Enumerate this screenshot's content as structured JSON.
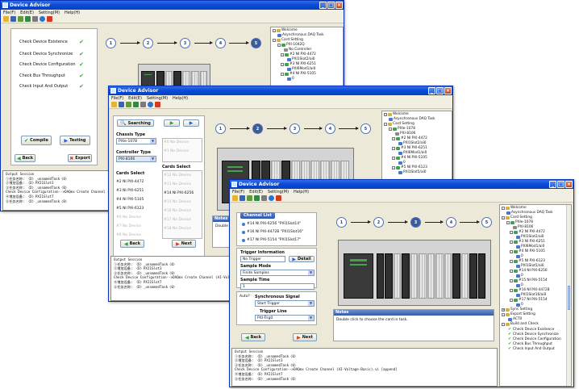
{
  "app": {
    "title": "Device Advisor",
    "menu": [
      "File(F)",
      "Edit(E)",
      "Setting(M)",
      "Help(H)"
    ]
  },
  "icons": {
    "ok": "✔",
    "compile": "✔",
    "testing": "▶",
    "back": "◀",
    "export": "✖",
    "next": "▶",
    "searching": "🔍",
    "arrow": "▶"
  },
  "win1": {
    "checks": [
      "Check Device Existence",
      "Check Device Synchronize",
      "Check Device Configuration",
      "Check Bus Throughput",
      "Check Input And Output"
    ],
    "compile_label": "Compile",
    "testing_label": "Testing",
    "back_label": "Back",
    "export_label": "Export",
    "steps": [
      "1",
      "2",
      "3",
      "4",
      "5"
    ],
    "console": [
      "Output Session",
      "①任务名称: 〈D〉_unnamedTask〈0〉",
      "②增加设备: 〈D〉PXI1Slot3",
      "③任务名称: 〈D〉_unnamedTask〈0〉",
      "Check Device Configuration-->DAQmx Create Channel (AI-Voltage-Basic)",
      "④增加设备: 〈D〉PXI1Slot7",
      "",
      "⑤任务名称: 〈D〉_unnamedTask〈0〉"
    ],
    "tree": [
      "Welcome",
      "Asynchronous DAQ Task",
      "Card Setting",
      "PXI-1042Q",
      "No Controller",
      "#2 NI PXI-4472",
      "PXI1Slot2/ai0",
      "#3 NI PXI-6251",
      "PXI6Mod1/ai0",
      "#4 NI PXI-5105",
      "0"
    ]
  },
  "win2": {
    "searching_label": "Searching",
    "chassis_type_label": "Chassis Type",
    "chassis_type_value": "PXIe-1078",
    "controller_type_label": "Controller Type",
    "controller_type_value": "PXI-8106",
    "cards_select_label": "Cards Select",
    "cards_select_label_right": "Cards Select",
    "left_cards": [
      "#2 NI PXI-4472",
      "#3 NI PXI-6251",
      "#4 NI PXI-5105",
      "#5 NI PXI-6123",
      "#6 No Device",
      "#7 No Device",
      "#8 No Device"
    ],
    "right_controller": [
      "#0 No Device",
      "#1 No Device"
    ],
    "right_cards": [
      "#12 No Device",
      "#13 No Device",
      "#14 NI PXI-6256",
      "#15 No Device",
      "#16 No Device",
      "#17 No Device",
      "#18 No Device"
    ],
    "back_label": "Back",
    "next_label": "Next",
    "steps": [
      "1",
      "2",
      "3",
      "4",
      "5"
    ],
    "notes_label": "Notes",
    "notes_text": "Double click to choose the card in task.",
    "console": [
      "Output Session",
      "①任务名称: 〈D〉_unnamedTask〈0〉",
      "②增加设备: 〈D〉PXI1Slot3",
      "③任务名称: 〈D〉_unnamedTask〈0〉",
      "Check Device Configuration-->DAQmx Create Channel (AI-Voltage-Basic).vi",
      "④增加设备: 〈D〉PXI1Slot7",
      "",
      "⑤任务名称: 〈D〉_unnamedTask〈0〉"
    ],
    "tree": [
      "Welcome",
      "Asynchronous DAQ Task",
      "Card Setting",
      "PXIe-1078",
      "PXI-8106",
      "#2 NI PXI-4472",
      "PXI1Slot2/ai0",
      "#3 NI PXI-6251",
      "PXI6Mod1/ai0",
      "#4 NI PXI-5105",
      "0",
      "#5 NI PXI-6123",
      "PXI1Slot5/ai0"
    ]
  },
  "win3": {
    "channel_list_label": "Channel List",
    "channels": [
      "#14 NI PXI-6256 \"PXI1Slot14\"",
      "#16 NI PXI-4472B \"PXI1Slot16\"",
      "#17 NI PXI-5154 \"PXI1Slot17\""
    ],
    "trigger_info_label": "Trigger Information",
    "trigger_value": "No Trigger",
    "detail_label": "Detail",
    "sample_mode_label": "Sample Mode",
    "sample_mode_value": "Finite Samples",
    "sample_time_label": "Sample Time",
    "sample_time_value": "1",
    "auto_label": "Auto?",
    "sync_signal_label": "Synchronous Signal",
    "sync_signal_value": "Start Trigger",
    "trigger_line_label": "Trigger Line",
    "trigger_line_value": "PXI-Trig0",
    "back_label": "Back",
    "next_label": "Next",
    "steps": [
      "1",
      "2",
      "3",
      "4",
      "5"
    ],
    "notes_label": "Notes",
    "notes_text": "Double click to choose the card in task.",
    "console": [
      "Output Session",
      "①任务名称: 〈D〉_unnamedTask〈0〉",
      "②增加设备: 〈D〉PXI1Slot3",
      "③任务名称: 〈D〉_unnamedTask〈0〉",
      "Check Device Configuration-->DAQmx Create Channel (AI-Voltage-Basic).vi [append]",
      "④增加设备: 〈D〉PXI1Slot7",
      "",
      "⑤任务名称: 〈D〉_unnamedTask〈0〉"
    ],
    "tree": [
      "Welcome",
      "Asynchronous DAQ Task",
      "Card Setting",
      "PXIe-1078",
      "PXI-8106",
      "#2 NI PXI-4472",
      "PXI1Slot2/ai0",
      "#3 NI PXI-6251",
      "PXI6Mod1/ai0",
      "#4 NI PXI-5105",
      "0",
      "#5 NI PXI-6123",
      "PXI1Slot5/ai0",
      "#14 NI PXI-6256",
      "0",
      "#15 NI PXI-5154",
      "0",
      "#16 NI PXI-4472B",
      "PXI1Slot16/ai0",
      "#17 NI PXI-5154",
      "0",
      "Sync Setting",
      "Export Setting",
      "ACT0",
      "Build and Check",
      "Check Device Existence",
      "Check Device Synchronize",
      "Check Device Configuration",
      "Check Bus Throughput",
      "Check Input And Output"
    ]
  }
}
